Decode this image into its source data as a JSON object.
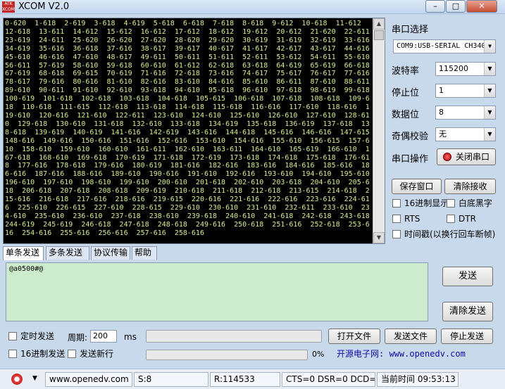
{
  "window": {
    "title": "XCOM V2.0",
    "logo_text": "ATK\nXCOM"
  },
  "window_buttons": {
    "minimize": "–",
    "maximize": "□",
    "close": "✕"
  },
  "receive_text": "0-620  1-618  2-619  3-618  4-619  5-618  6-618  7-618  8-618  9-612  10-618  11-612  12-618  13-611  14-612  15-612  16-612  17-612  18-612  19-612  20-612  21-620  22-611  23-619  24-611  25-620  26-620  27-620  28-620  29-620  30-619  31-619  32-619  33-616  34-619  35-616  36-618  37-616  38-617  39-617  40-617  41-617  42-617  43-617  44-616  45-610  46-616  47-610  48-617  49-611  50-611  51-611  52-611  53-612  54-611  55-610  56-611  57-619  58-610  59-618  60-610  61-612  62-618  63-618  64-619  65-619  66-618  67-619  68-618  69-615  70-619  71-616  72-618  73-616  74-617  75-617  76-617  77-616  78-617  79-616  80-616  81-610  82-616  83-610  84-616  85-610  86-611  87-610  88-611  89-610  90-611  91-610  92-610  93-618  94-610  95-618  96-610  97-618  98-619  99-618  100-619  101-618  102-618  103-618  104-618  105-615  106-618  107-618  108-618  109-618  110-618  111-615  112-618  113-618  114-618  115-618  116-616  117-610  118-616  119-610  120-616  121-610  122-611  123-610  124-610  125-610  126-610  127-610  128-610  129-618  130-610  131-618  132-610  133-618  134-619  135-618  136-619  137-618  138-618  139-619  140-619  141-616  142-619  143-616  144-618  145-616  146-616  147-615  148-616  149-616  150-616  151-616  152-616  153-610  154-616  155-610  156-615  157-610  158-610  159-610  160-610  161-611  162-610  163-611  164-610  165-619  166-610  167-618  168-610  169-618  170-619  171-618  172-619  173-618  174-618  175-618  176-618  177-616  178-618  179-616  180-619  181-616  182-616  183-616  184-616  185-616  186-616  187-616  188-616  189-610  190-616  191-610  192-616  193-610  194-610  195-610  196-610  197-610  198-610  199-610  200-610  201-618  202-610  203-618  204-610  205-618  206-618  207-618  208-618  209-619  210-618  211-618  212-618  213-615  214-618  215-616  216-618  217-616  218-616  219-615  220-616  221-616  222-616  223-616  224-616  225-610  226-615  227-610  228-615  229-610  230-610  231-610  232-611  233-610  234-610  235-610  236-610  237-618  238-610  239-618  240-610  241-618  242-618  243-618  244-619  245-619  246-618  247-618  248-618  249-616  250-618  251-616  252-618  253-616  254-616  255-616  256-616  257-616  258-616",
  "sidebar": {
    "port_label": "串口选择",
    "port_value": "COM9:USB-SERIAL CH340",
    "baud_label": "波特率",
    "baud_value": "115200",
    "stop_label": "停止位",
    "stop_value": "1",
    "data_label": "数据位",
    "data_value": "8",
    "parity_label": "奇偶校验",
    "parity_value": "无",
    "operation_label": "串口操作",
    "operation_button": "关闭串口",
    "save_window_button": "保存窗口",
    "clear_receive_button": "清除接收",
    "hex_display_label": "16进制显示",
    "white_bg_label": "白底黑字",
    "rts_label": "RTS",
    "dtr_label": "DTR",
    "timestamp_label": "时间戳(以换行回车断帧)"
  },
  "tabs": [
    "单条发送",
    "多条发送",
    "协议传输",
    "帮助"
  ],
  "send": {
    "text": "@a0500#@",
    "send_button": "发送",
    "clear_send_button": "清除发送",
    "timed_send_label": "定时发送",
    "period_label": "周期:",
    "period_value": "200",
    "period_unit": "ms",
    "open_file_button": "打开文件",
    "send_file_button": "发送文件",
    "stop_send_button": "停止发送",
    "hex_send_label": "16进制发送",
    "send_newline_label": "发送新行",
    "progress_percent": "0%",
    "url_text": "开源电子网: www.openedv.com"
  },
  "status": {
    "website": "www.openedv.com",
    "sent": "S:8",
    "received": "R:114533",
    "lines": "CTS=0 DSR=0 DCD=0",
    "time": "当前时间 09:53:13"
  },
  "colors": {
    "terminal_bg": "#000000",
    "terminal_fg": "#d8ee90",
    "send_bg": "#cdeccd",
    "url": "#0a0aa8"
  }
}
